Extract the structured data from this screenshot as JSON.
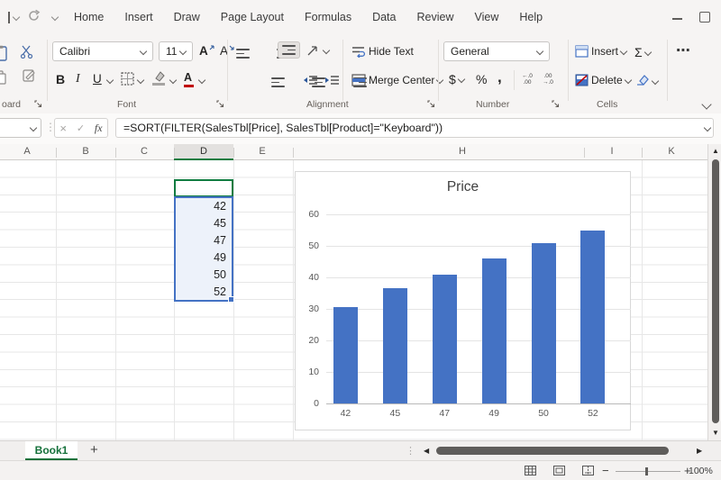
{
  "titlebar": {
    "tabs": [
      "Home",
      "Insert",
      "Draw",
      "Page Layout",
      "Formulas",
      "Data",
      "Review",
      "View",
      "Help"
    ]
  },
  "ribbon": {
    "clipboard": {
      "label": "oard"
    },
    "font": {
      "label": "Font",
      "family": "Calibri",
      "size": "11",
      "bold": "B",
      "italic": "I",
      "underline": "U",
      "grow": "A",
      "shrink": "A",
      "color_letter": "A"
    },
    "alignment": {
      "label": "Alignment",
      "wrap_text": "Hide Text",
      "merge_center": "Merge Center"
    },
    "number": {
      "label": "Number",
      "format": "General",
      "currency": "$",
      "percent": "%",
      "comma": ",",
      "inc_top": "←.0",
      "inc_bottom": ".00",
      "dec_top": ".00",
      "dec_bottom": "→.0"
    },
    "cells": {
      "label": "Cells",
      "insert": "Insert",
      "delete": "Delete",
      "autosum": "Σ",
      "more": "⋯"
    }
  },
  "formula_bar": {
    "cancel": "×",
    "enter": "✓",
    "fx": "fx",
    "formula": "=SORT(FILTER(SalesTbl[Price], SalesTbl[Product]=\"Keyboard\"))"
  },
  "grid": {
    "column_labels": [
      "A",
      "B",
      "C",
      "D",
      "E",
      "H",
      "I",
      "K"
    ],
    "selected_column": "D",
    "spill_values": [
      "42",
      "45",
      "47",
      "49",
      "50",
      "52"
    ]
  },
  "chart_data": {
    "type": "bar",
    "title": "Price",
    "categories": [
      "42",
      "45",
      "47",
      "49",
      "50",
      "52"
    ],
    "values": [
      30.5,
      36.5,
      41,
      46,
      51,
      55
    ],
    "xlabel": "",
    "ylabel": "",
    "ylim": [
      0,
      60
    ],
    "ytick_step": 10,
    "grid": true,
    "legend": false,
    "bar_color": "#4472c4"
  },
  "sheet_bar": {
    "active_tab": "Book1",
    "add_tab": "+"
  },
  "status_bar": {
    "zoom": "100%",
    "zoom_out": "−",
    "zoom_in": "+"
  }
}
